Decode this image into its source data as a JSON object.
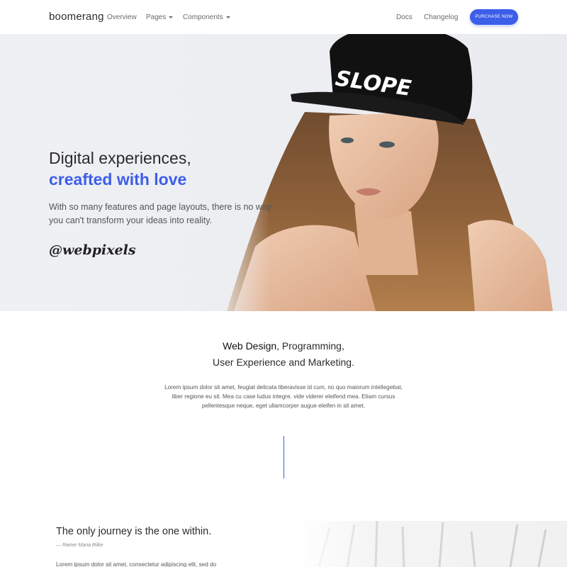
{
  "navbar": {
    "brand": "boomerang",
    "links": [
      "Overview",
      "Pages",
      "Components"
    ],
    "right_links": [
      "Docs",
      "Changelog"
    ],
    "cta_label": "PURCHASE NOW"
  },
  "hero": {
    "title_line1": "Digital experiences,",
    "title_line2": "creafted with love",
    "subtitle": "With so many features and page layouts, there is no way you can't transform your ideas into reality.",
    "signature": "@webpixels",
    "cap_text": "SLOPE"
  },
  "services": {
    "line1_bold": "Web Design",
    "line1_rest": ", Programming,",
    "line2": "User Experience and Marketing.",
    "paragraph": "Lorem ipsum dolor sit amet, feugiat delicata liberavisse id cum, no quo maiorum intellegebat, liber regione eu sit. Mea cu case ludus integre, vide viderer eleifend mea. Etiam cursus pellentesque neque, eget ullamcorper augue eleifen in sit amet."
  },
  "quote": {
    "title": "The only journey is the one within.",
    "author": "— Rainer Maria Rilke",
    "paragraph": "Lorem ipsum dolor sit amet, consectetur adipiscing elit, sed do"
  },
  "colors": {
    "accent": "#3d5ee9",
    "text_dark": "#2b2b2b",
    "hero_bg": "#eceef2"
  }
}
